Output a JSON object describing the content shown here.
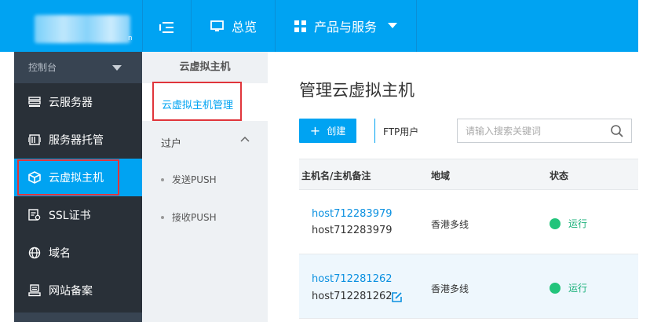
{
  "topbar": {
    "logo_letter": "n",
    "overview": "总览",
    "products": "产品与服务"
  },
  "sidebar": {
    "console": "控制台",
    "items": [
      {
        "label": "云服务器",
        "icon": "server-list-icon"
      },
      {
        "label": "服务器托管",
        "icon": "rack-icon"
      },
      {
        "label": "云虚拟主机",
        "icon": "cube-icon",
        "active": true
      },
      {
        "label": "SSL证书",
        "icon": "certificate-icon"
      },
      {
        "label": "域名",
        "icon": "globe-icon"
      },
      {
        "label": "网站备案",
        "icon": "printer-icon"
      }
    ]
  },
  "subnav": {
    "title": "云虚拟主机",
    "manage": "云虚拟主机管理",
    "group": "过户",
    "items": [
      "发送PUSH",
      "接收PUSH"
    ]
  },
  "main": {
    "title": "管理云虚拟主机",
    "create": "创建",
    "ftp": "FTP用户",
    "search_placeholder": "请输入搜索关键词",
    "columns": [
      "主机名/主机备注",
      "地域",
      "状态"
    ],
    "rows": [
      {
        "host": "host712283979",
        "note": "host712283979",
        "region": "香港多线",
        "status": "运行"
      },
      {
        "host": "host712281262",
        "note": "host712281262",
        "region": "香港多线",
        "status": "运行"
      }
    ]
  },
  "colors": {
    "accent": "#00a3f2",
    "sidebar": "#293038",
    "highlight_box": "#e0353b",
    "running": "#22c47b"
  }
}
